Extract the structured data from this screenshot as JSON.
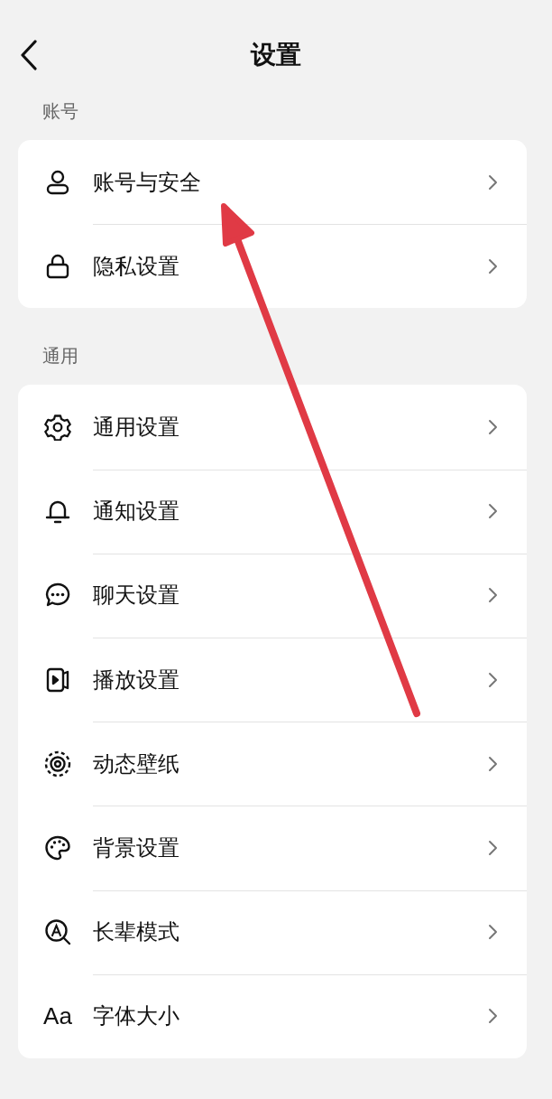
{
  "header": {
    "title": "设置"
  },
  "sections": [
    {
      "label": "账号",
      "items": [
        {
          "kind": "user",
          "label": "账号与安全"
        },
        {
          "kind": "lock",
          "label": "隐私设置"
        }
      ]
    },
    {
      "label": "通用",
      "items": [
        {
          "kind": "gear",
          "label": "通用设置"
        },
        {
          "kind": "bell",
          "label": "通知设置"
        },
        {
          "kind": "chat",
          "label": "聊天设置"
        },
        {
          "kind": "play",
          "label": "播放设置"
        },
        {
          "kind": "wallpaper",
          "label": "动态壁纸"
        },
        {
          "kind": "palette",
          "label": "背景设置"
        },
        {
          "kind": "elder",
          "label": "长辈模式"
        },
        {
          "kind": "text",
          "icon_text": "Aa",
          "label": "字体大小"
        }
      ]
    }
  ],
  "annotation": {
    "kind": "arrow",
    "color": "#e03a45"
  }
}
